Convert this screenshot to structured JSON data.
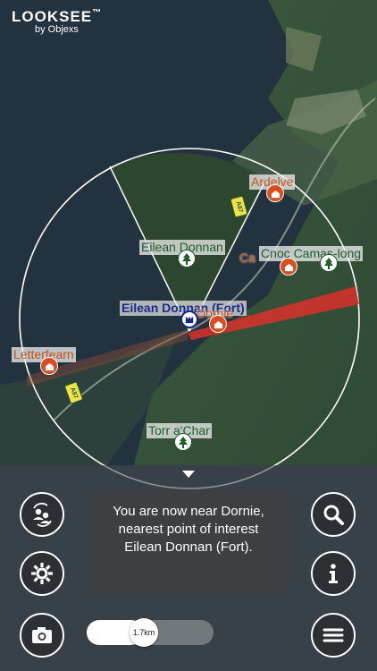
{
  "brand": {
    "name": "LOOKSEE",
    "tm": "™",
    "by": "by Objexs"
  },
  "map": {
    "labels": {
      "ardelve": "Ardelve",
      "eilean_donnan": "Eilean Donnan",
      "cnoc": "Cnoc Camas-long",
      "caisteal": "Ca",
      "fort": "Eilean Donnan (Fort)",
      "dornie": "Dornie",
      "letterfearn": "Letterfearn",
      "torr": "Torr a'Char"
    },
    "road_label": "A87"
  },
  "message": "You are now near Dornie, nearest point of interest Eilean Donnan (Fort).",
  "slider": {
    "value_label": "1.7km"
  },
  "buttons": {
    "switch_user": "switch-users-icon",
    "settings": "gear-icon",
    "camera": "camera-icon",
    "search": "search-icon",
    "info": "info-icon",
    "menu": "menu-list-icon"
  },
  "colors": {
    "orange": "#c5521f",
    "green": "#1f5d2b",
    "blue": "#1b2d8a",
    "beam": "#d9302a"
  }
}
